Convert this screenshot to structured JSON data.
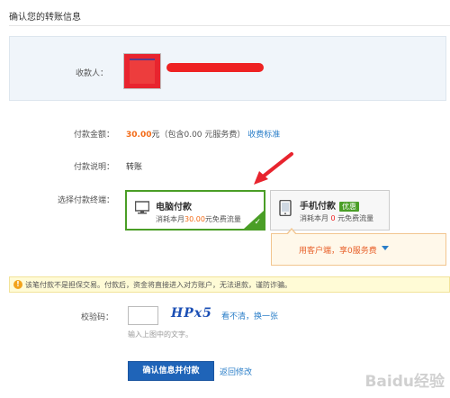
{
  "page": {
    "title": "确认您的转账信息"
  },
  "payee": {
    "label": "收款人："
  },
  "amount": {
    "label": "付款金额：",
    "value": "30.00",
    "unit": "元",
    "fee_note": "（包含0.00 元服务费）",
    "fee_link": "收费标准"
  },
  "description": {
    "label": "付款说明：",
    "value": "转账"
  },
  "terminal": {
    "label": "选择付款终端：",
    "pc": {
      "title": "电脑付款",
      "sub_prefix": "消耗本月",
      "sub_amount": "30.00",
      "sub_suffix": "元免费流量",
      "check": "✓",
      "selected": true
    },
    "mobile": {
      "title": "手机付款",
      "badge": "优惠",
      "sub_prefix": "消耗本月 ",
      "sub_amount": "0",
      "sub_suffix": " 元免费流量",
      "selected": false
    },
    "promo": {
      "text": "用客户端，享0服务费"
    }
  },
  "warning": {
    "icon": "!",
    "text": "该笔付款不是担保交易。付款后，资金将直接进入对方账户，无法退款，谨防诈骗。"
  },
  "captcha": {
    "label": "校验码：",
    "image_text": "HPx5",
    "refresh_link": "看不清，换一张",
    "hint": "输入上图中的文字。",
    "value": ""
  },
  "actions": {
    "confirm_label": "确认信息并付款",
    "back_label": "返回修改"
  },
  "watermark": "Baidu经验",
  "colors": {
    "accent_blue": "#1f64b8",
    "selected_green": "#4a9e26",
    "amount_orange": "#f36b17",
    "redaction_red": "#ee2222",
    "arrow_red": "#e8242e"
  }
}
